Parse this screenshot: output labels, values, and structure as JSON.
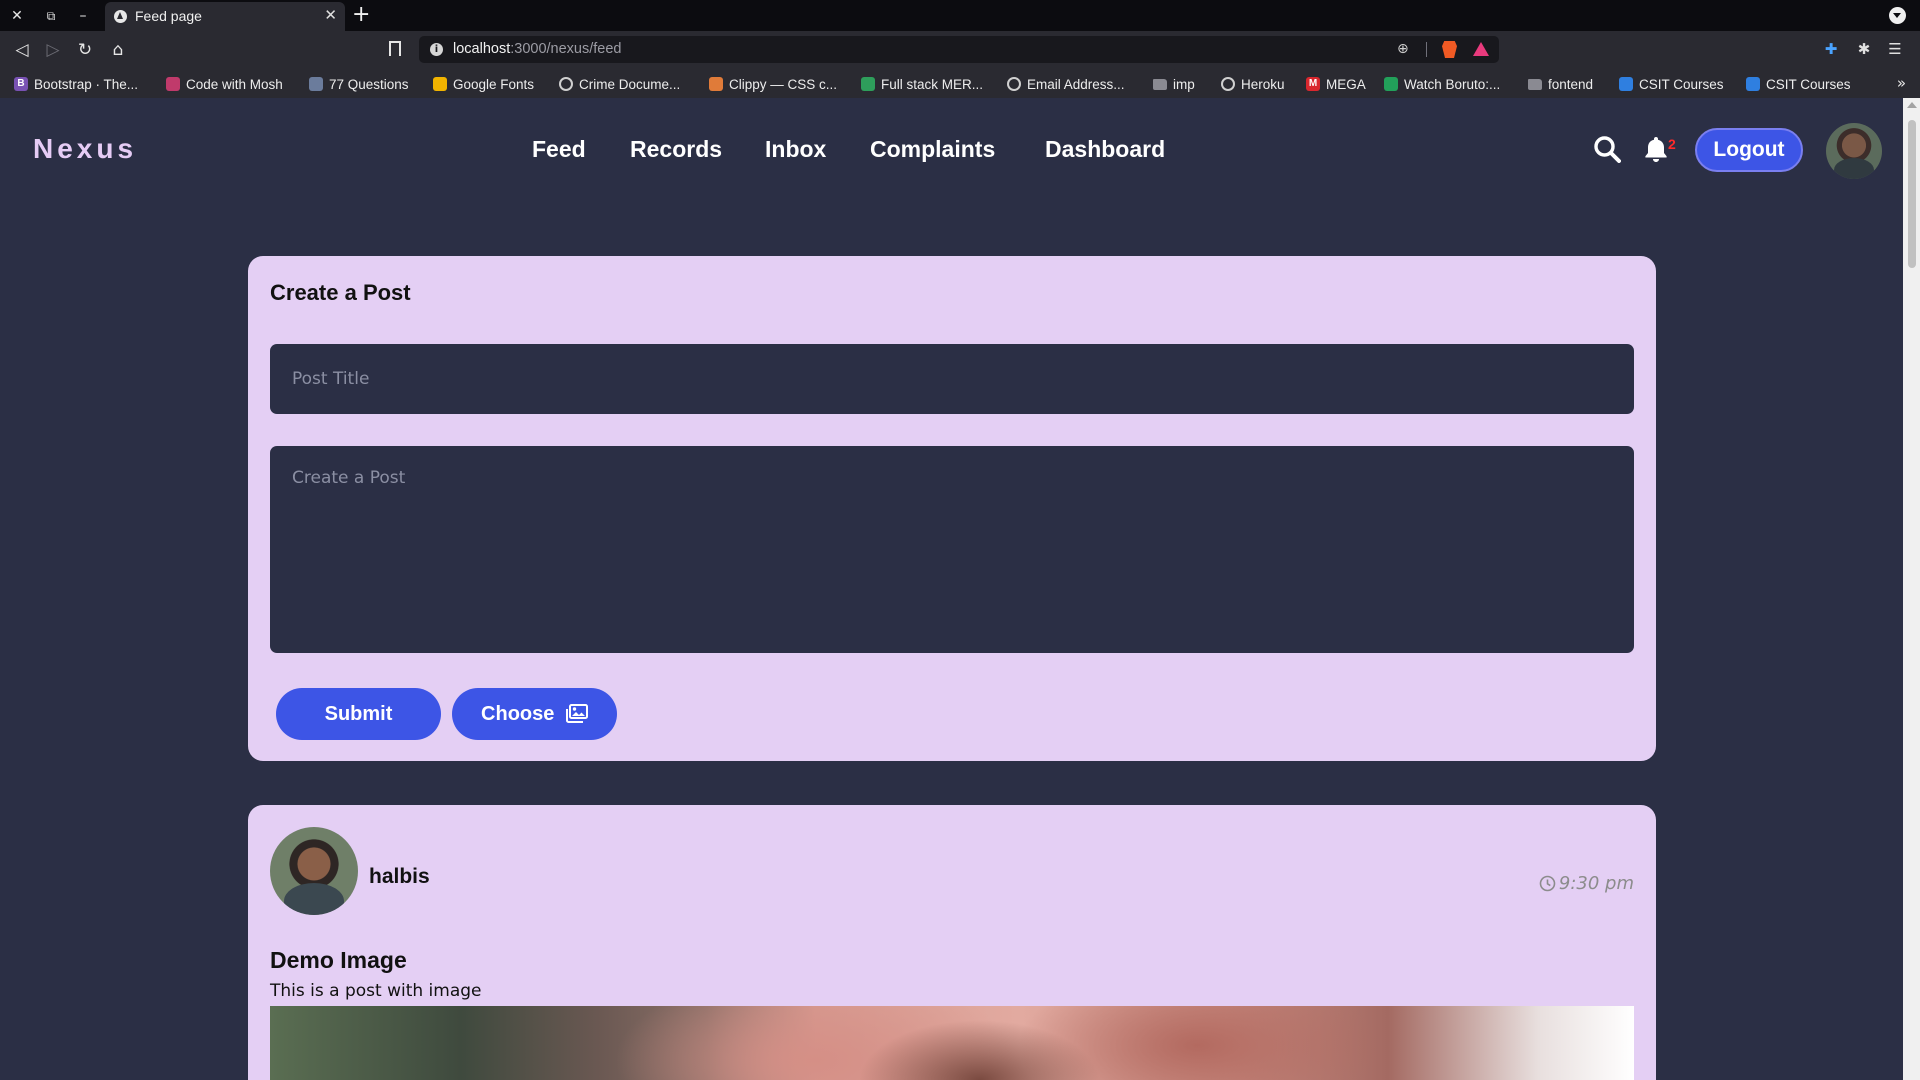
{
  "browser": {
    "tab_title": "Feed page",
    "url_host": "localhost",
    "url_path": ":3000/nexus/feed",
    "bookmarks": [
      {
        "label": "Bootstrap · The...",
        "icon": "bootstrap-icon",
        "color": "#7952b3",
        "glyph": "B"
      },
      {
        "label": "Code with Mosh",
        "icon": "mosh-icon",
        "color": "#c03a6b",
        "glyph": ""
      },
      {
        "label": "77 Questions",
        "icon": "questions-icon",
        "color": "#6b7c9c",
        "glyph": ""
      },
      {
        "label": "Google Fonts",
        "icon": "google-fonts-icon",
        "color": "#f2b400",
        "glyph": ""
      },
      {
        "label": "Crime Docume...",
        "icon": "globe-icon",
        "color": "#d0d0d0",
        "glyph": ""
      },
      {
        "label": "Clippy — CSS c...",
        "icon": "clippy-icon",
        "color": "#e07b39",
        "glyph": ""
      },
      {
        "label": "Full stack MER...",
        "icon": "code-icon",
        "color": "#2e9e5b",
        "glyph": ""
      },
      {
        "label": "Email Address...",
        "icon": "globe-icon",
        "color": "#d0d0d0",
        "glyph": ""
      },
      {
        "label": "imp",
        "icon": "folder-icon",
        "color": "#8a8a92",
        "glyph": ""
      },
      {
        "label": "Heroku",
        "icon": "globe-icon",
        "color": "#d0d0d0",
        "glyph": ""
      },
      {
        "label": "MEGA",
        "icon": "mega-icon",
        "color": "#d9272e",
        "glyph": "M"
      },
      {
        "label": "Watch Boruto:...",
        "icon": "boruto-icon",
        "color": "#22a05a",
        "glyph": ""
      },
      {
        "label": "fontend",
        "icon": "folder-icon",
        "color": "#8a8a92",
        "glyph": ""
      },
      {
        "label": "CSIT Courses",
        "icon": "csit-icon",
        "color": "#2f7fe0",
        "glyph": ""
      },
      {
        "label": "CSIT Courses",
        "icon": "csit-icon",
        "color": "#2f7fe0",
        "glyph": ""
      }
    ]
  },
  "navbar": {
    "brand": "Nexus",
    "links": [
      "Feed",
      "Records",
      "Inbox",
      "Complaints",
      "Dashboard"
    ],
    "notification_count": "2",
    "logout_label": "Logout",
    "accent_color": "#3d55e6"
  },
  "create_post": {
    "heading": "Create a Post",
    "title_placeholder": "Post Title",
    "body_placeholder": "Create a Post",
    "submit_label": "Submit",
    "choose_label": "Choose"
  },
  "post": {
    "username": "halbis",
    "time": "9:30 pm",
    "title": "Demo Image",
    "body": "This is a post with image"
  },
  "colors": {
    "page_bg": "#2b2f45",
    "card_bg": "#e4cff4",
    "brand": "#e6ccf5",
    "badge": "#ff2a2a"
  }
}
